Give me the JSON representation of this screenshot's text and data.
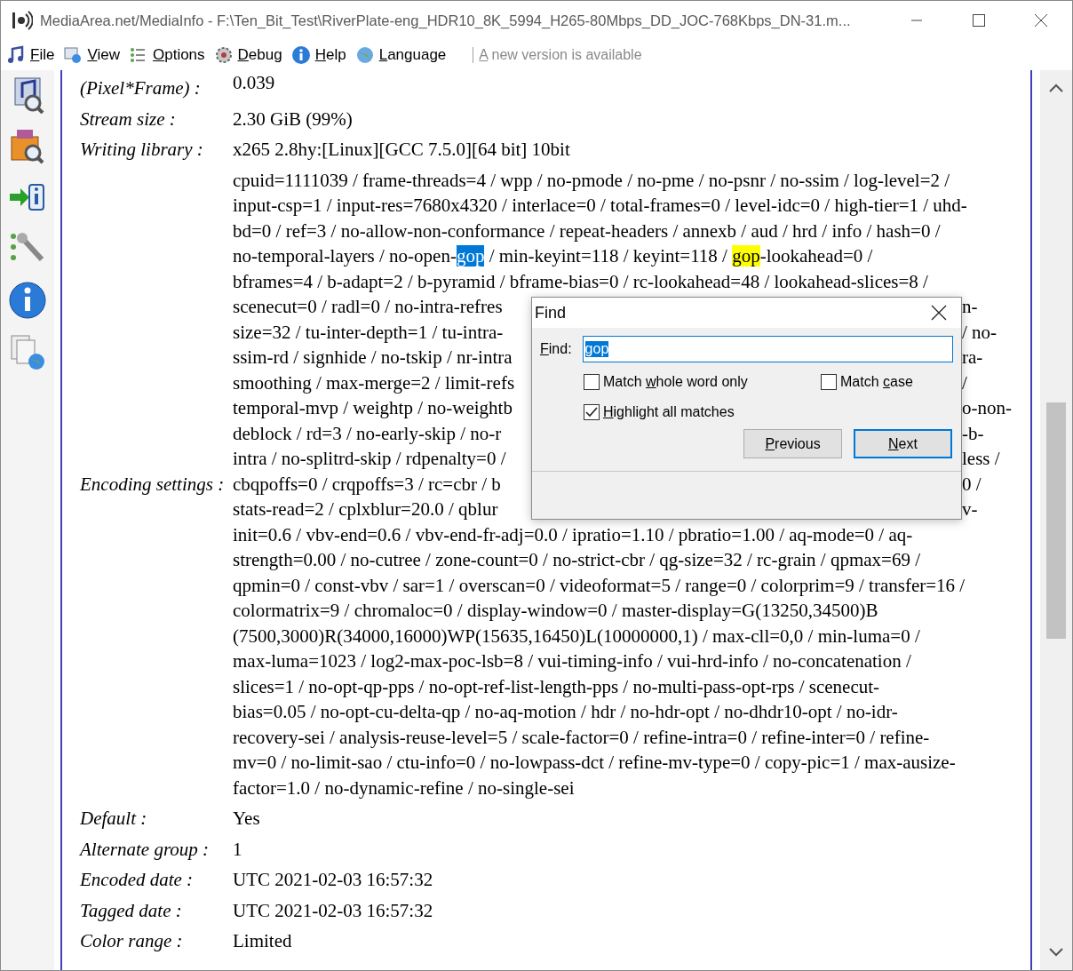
{
  "window": {
    "title": "MediaArea.net/MediaInfo - F:\\Ten_Bit_Test\\RiverPlate-eng_HDR10_8K_5994_H265-80Mbps_DD_JOC-768Kbps_DN-31.m..."
  },
  "menu": [
    {
      "key": "F",
      "post": "ile"
    },
    {
      "key": "V",
      "post": "iew"
    },
    {
      "key": "O",
      "post": "ptions"
    },
    {
      "key": "D",
      "post": "ebug"
    },
    {
      "key": "H",
      "post": "elp"
    },
    {
      "key": "L",
      "post": "anguage"
    }
  ],
  "update_notice": {
    "key": "A",
    "post": " new version is available",
    "disabled": true
  },
  "info_rows": [
    {
      "label": "(Pixel*Frame) :",
      "value_lines": [
        {
          "kind": "full",
          "text": "0.039"
        }
      ]
    },
    {
      "label": "Stream size :",
      "value_lines": [
        {
          "kind": "full",
          "text": "2.30 GiB (99%)"
        }
      ]
    },
    {
      "label": "Writing library :",
      "value_lines": [
        {
          "kind": "full",
          "text": "x265 2.8hy:[Linux][GCC 7.5.0][64 bit] 10bit"
        }
      ]
    },
    {
      "label": "Encoding settings :",
      "value_lines": [
        {
          "kind": "full",
          "text": "cpuid=1111039 / frame-threads=4 / wpp / no-pmode / no-pme / no-psnr / no-ssim / log-level=2 /"
        },
        {
          "kind": "full",
          "text": "input-csp=1 / input-res=7680x4320 / interlace=0 / total-frames=0 / level-idc=0 / high-tier=1 / uhd-"
        },
        {
          "kind": "full",
          "text": "bd=0 / ref=3 / no-allow-non-conformance / repeat-headers / annexb / aud / hrd / info / hash=0 /"
        },
        {
          "kind": "highlighted",
          "parts": [
            {
              "text": "no-temporal-layers / no-open-",
              "matched": false
            },
            {
              "text": "gop",
              "matched": true,
              "current": true
            },
            {
              "text": " / min-keyint=118 / keyint=118 / ",
              "matched": false
            },
            {
              "text": "gop",
              "matched": true,
              "current": false
            },
            {
              "text": "-lookahead=0 /",
              "matched": false
            }
          ]
        },
        {
          "kind": "full",
          "text": "bframes=4 / b-adapt=2 / b-pyramid / bframe-bias=0 / rc-lookahead=48 / lookahead-slices=8 /"
        },
        {
          "kind": "covered",
          "left": "scenecut=0 / radl=0 / no-intra-refres",
          "right": "n-"
        },
        {
          "kind": "covered",
          "left": "size=32 / tu-inter-depth=1 / tu-intra-",
          "right": "/ no-"
        },
        {
          "kind": "covered",
          "left": "ssim-rd / signhide / no-tskip / nr-intra",
          "right": "ra-"
        },
        {
          "kind": "covered",
          "left": "smoothing / max-merge=2 / limit-refs",
          "right": "/"
        },
        {
          "kind": "covered",
          "left": "temporal-mvp / weightp / no-weightb",
          "right": "o-non-"
        },
        {
          "kind": "covered",
          "left": "deblock / rd=3 / no-early-skip / no-r",
          "right": "-b-"
        },
        {
          "kind": "covered",
          "left": "intra / no-splitrd-skip / rdpenalty=0 /",
          "right": "less /"
        },
        {
          "kind": "covered",
          "left": "cbqpoffs=0 / crqpoffs=3 / rc=cbr / b",
          "right": "0 /"
        },
        {
          "kind": "covered",
          "left": "stats-read=2 / cplxblur=20.0 / qblur",
          "right": "v-"
        },
        {
          "kind": "full",
          "text": "init=0.6 / vbv-end=0.6 / vbv-end-fr-adj=0.0 / ipratio=1.10 / pbratio=1.00 / aq-mode=0 / aq-"
        },
        {
          "kind": "full",
          "text": "strength=0.00 / no-cutree / zone-count=0 / no-strict-cbr / qg-size=32 / rc-grain / qpmax=69 /"
        },
        {
          "kind": "full",
          "text": "qpmin=0 / const-vbv / sar=1 / overscan=0 / videoformat=5 / range=0 / colorprim=9 / transfer=16 /"
        },
        {
          "kind": "full",
          "text": "colormatrix=9 / chromaloc=0 / display-window=0 / master-display=G(13250,34500)B"
        },
        {
          "kind": "full",
          "text": "(7500,3000)R(34000,16000)WP(15635,16450)L(10000000,1) / max-cll=0,0 / min-luma=0 /"
        },
        {
          "kind": "full",
          "text": "max-luma=1023 / log2-max-poc-lsb=8 / vui-timing-info / vui-hrd-info / no-concatenation /"
        },
        {
          "kind": "full",
          "text": "slices=1 / no-opt-qp-pps / no-opt-ref-list-length-pps / no-multi-pass-opt-rps / scenecut-"
        },
        {
          "kind": "full",
          "text": "bias=0.05 / no-opt-cu-delta-qp / no-aq-motion / hdr / no-hdr-opt / no-dhdr10-opt / no-idr-"
        },
        {
          "kind": "full",
          "text": "recovery-sei / analysis-reuse-level=5 / scale-factor=0 / refine-intra=0 / refine-inter=0 / refine-"
        },
        {
          "kind": "full",
          "text": "mv=0 / no-limit-sao / ctu-info=0 / no-lowpass-dct / refine-mv-type=0 / copy-pic=1 / max-ausize-"
        },
        {
          "kind": "full",
          "text": "factor=1.0 / no-dynamic-refine / no-single-sei"
        }
      ]
    },
    {
      "label": "Default :",
      "value_lines": [
        {
          "kind": "full",
          "text": "Yes"
        }
      ]
    },
    {
      "label": "Alternate group :",
      "value_lines": [
        {
          "kind": "full",
          "text": "1"
        }
      ]
    },
    {
      "label": "Encoded date :",
      "value_lines": [
        {
          "kind": "full",
          "text": "UTC 2021-02-03 16:57:32"
        }
      ]
    },
    {
      "label": "Tagged date :",
      "value_lines": [
        {
          "kind": "full",
          "text": "UTC 2021-02-03 16:57:32"
        }
      ]
    },
    {
      "label": "Color range :",
      "value_lines": [
        {
          "kind": "full",
          "text": "Limited"
        }
      ]
    }
  ],
  "find_dialog": {
    "title": "Find",
    "find_field": {
      "label": {
        "key": "F",
        "post": "ind:"
      },
      "value": "gop",
      "text_selected": true
    },
    "options": [
      {
        "label": {
          "pre": "Match ",
          "key": "w",
          "post": "hole word only"
        },
        "checked": false
      },
      {
        "label": {
          "pre": "Match ",
          "key": "c",
          "post": "ase"
        },
        "checked": false
      },
      {
        "label": {
          "key": "H",
          "post": "ighlight all matches"
        },
        "checked": true
      }
    ],
    "buttons": [
      {
        "label": {
          "key": "P",
          "post": "revious"
        },
        "default": false
      },
      {
        "label": {
          "key": "N",
          "post": "ext"
        },
        "default": true
      }
    ]
  }
}
